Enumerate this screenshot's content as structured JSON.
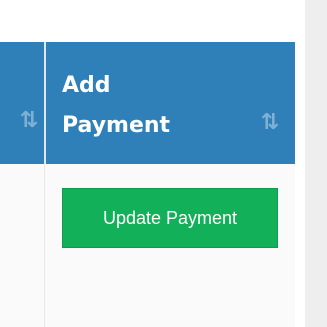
{
  "table": {
    "columns": [
      {
        "id": "previous",
        "label": "",
        "sort_icon": "sort-arrows-icon"
      },
      {
        "id": "add_payment",
        "label": "Add Payment",
        "sort_icon": "sort-arrows-icon"
      }
    ],
    "row": {
      "add_payment": {
        "button_label": "Update Payment"
      }
    }
  },
  "colors": {
    "header_bg": "#2f80b8",
    "header_text": "#ffffff",
    "sort_icon": "#7fb0d3",
    "button_bg": "#13b05a",
    "button_text": "#ffffff",
    "body_bg": "#fafafa",
    "side_panel": "#eeeeee"
  }
}
